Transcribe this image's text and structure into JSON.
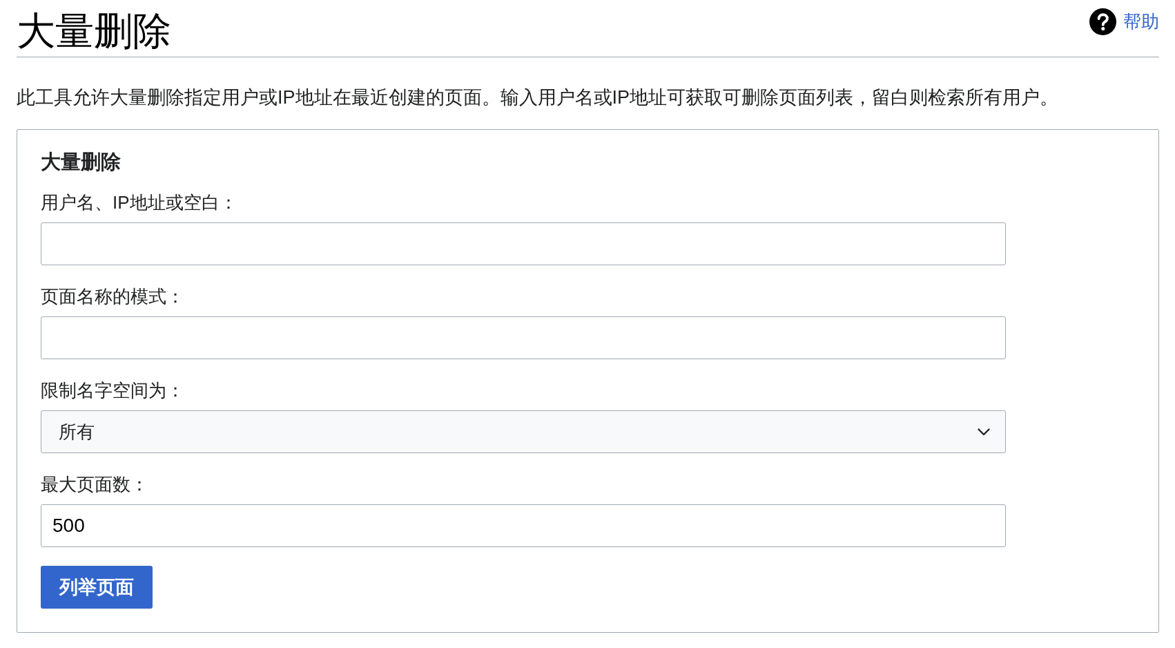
{
  "header": {
    "title": "大量删除",
    "help_link": "帮助"
  },
  "description": "此工具允许大量删除指定用户或IP地址在最近创建的页面。输入用户名或IP地址可获取可删除页面列表，留白则检索所有用户。",
  "form": {
    "legend": "大量删除",
    "fields": [
      {
        "kind": "text",
        "label": "用户名、IP地址或空白："
      },
      {
        "kind": "text",
        "label": "页面名称的模式："
      },
      {
        "kind": "select",
        "label": "限制名字空间为：",
        "value": "所有"
      },
      {
        "kind": "text",
        "label": "最大页面数：",
        "value": "500"
      }
    ],
    "submit_button": "列举页面"
  }
}
